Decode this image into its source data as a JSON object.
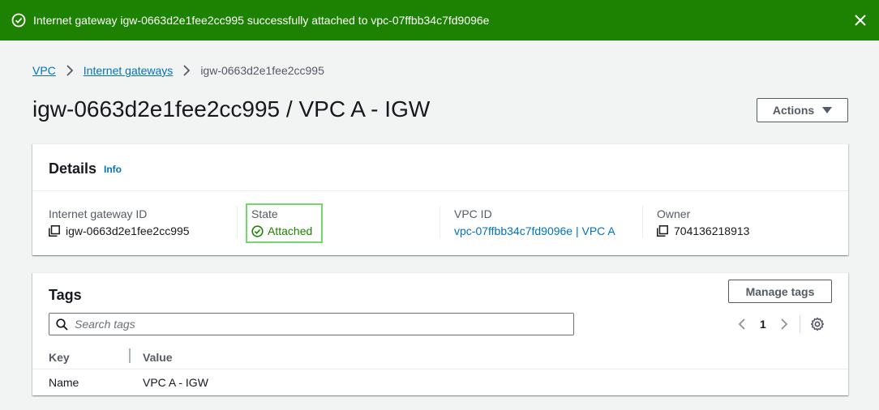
{
  "flash": {
    "message": "Internet gateway igw-0663d2e1fee2cc995 successfully attached to vpc-07ffbb34c7fd9096e",
    "bg_color": "#1d8102",
    "icon": "check-circle-icon",
    "close_icon": "close-icon"
  },
  "breadcrumb": {
    "items": [
      "VPC",
      "Internet gateways"
    ],
    "current": "igw-0663d2e1fee2cc995"
  },
  "page": {
    "title": "igw-0663d2e1fee2cc995 / VPC A - IGW",
    "actions_label": "Actions"
  },
  "details": {
    "heading": "Details",
    "info_label": "Info",
    "fields": {
      "igw_id": {
        "label": "Internet gateway ID",
        "value": "igw-0663d2e1fee2cc995"
      },
      "state": {
        "label": "State",
        "value": "Attached",
        "color": "#1d8102"
      },
      "vpc_id": {
        "label": "VPC ID",
        "value": "vpc-07ffbb34c7fd9096e | VPC A"
      },
      "owner": {
        "label": "Owner",
        "value": "704136218913"
      }
    }
  },
  "tags": {
    "heading": "Tags",
    "manage_label": "Manage tags",
    "search_placeholder": "Search tags",
    "page_number": "1",
    "columns": [
      "Key",
      "Value"
    ],
    "rows": [
      {
        "key": "Name",
        "value": "VPC A - IGW"
      }
    ]
  },
  "colors": {
    "link": "#0073bb",
    "background": "#f2f3f3"
  }
}
